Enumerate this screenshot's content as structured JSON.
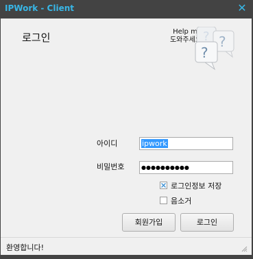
{
  "window": {
    "title": "IPWork - Client",
    "close_glyph": "✕"
  },
  "header": {
    "login_heading": "로그인",
    "help_line1": "Help me!",
    "help_line2": "도와주세요!",
    "help_graphic_icon": "help-question-bubbles-icon"
  },
  "form": {
    "id_label": "아이디",
    "id_value": "ipwork",
    "password_label": "비밀번호",
    "password_value": "●●●●●●●●●●"
  },
  "options": {
    "save_login": {
      "label": "로그인정보 저장",
      "checked": true
    },
    "mute": {
      "label": "음소거",
      "checked": false
    }
  },
  "buttons": {
    "signup": "회원가입",
    "login": "로그인"
  },
  "status": {
    "text": "환영합니다!"
  },
  "colors": {
    "title": "#38b6e6",
    "frame": "#434343",
    "selection": "#3399ff"
  }
}
